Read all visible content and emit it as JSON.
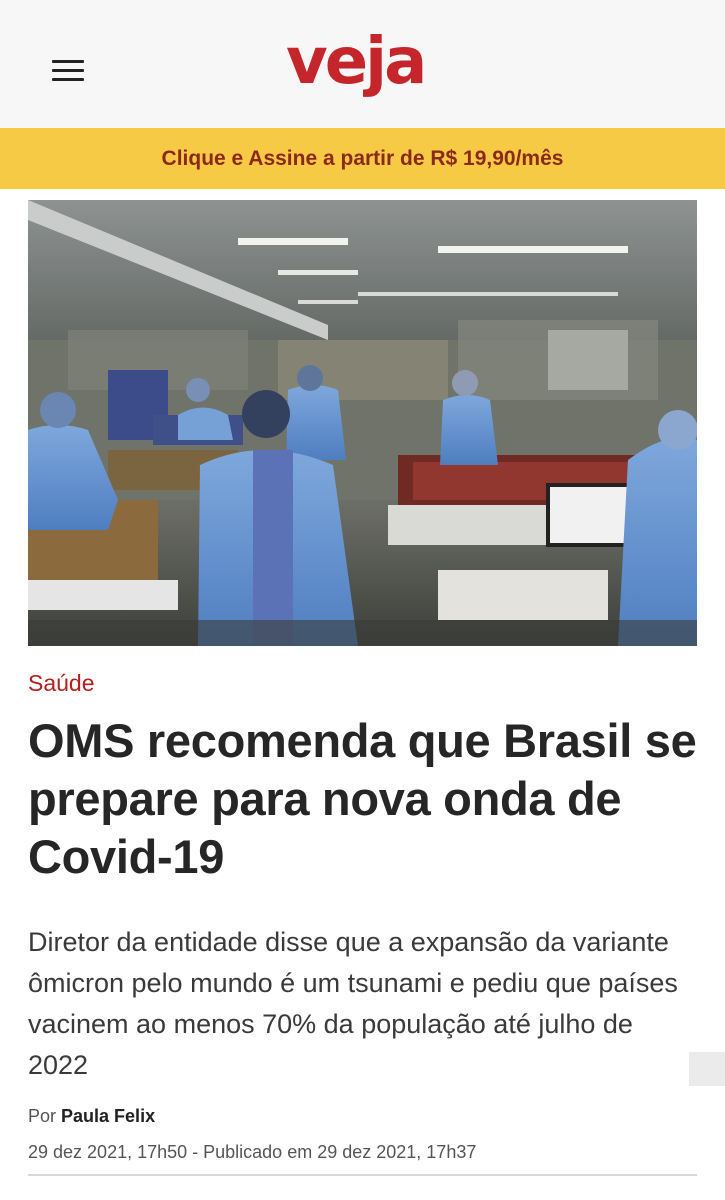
{
  "header": {
    "logo_text": "veja",
    "menu_icon": "hamburger-menu-icon"
  },
  "promo": {
    "label": "Clique e Assine a partir de R$ 19,90/mês"
  },
  "article": {
    "category": "Saúde",
    "headline": "OMS recomenda que Brasil se prepare para nova onda de Covid-19",
    "subtitle": "Diretor da entidade disse que a expansão da variante ômicron pelo mundo é um tsunami e pediu que países vacinem ao menos 70% da população até julho de 2022",
    "byline_prefix": "Por",
    "author": "Paula Felix",
    "dateline": "29 dez 2021, 17h50 - Publicado em 29 dez 2021, 17h37"
  },
  "colors": {
    "brand_red": "#c5262c",
    "promo_bg": "#f6ca45",
    "promo_text": "#8b2a1b",
    "category_red": "#b71d1d"
  }
}
